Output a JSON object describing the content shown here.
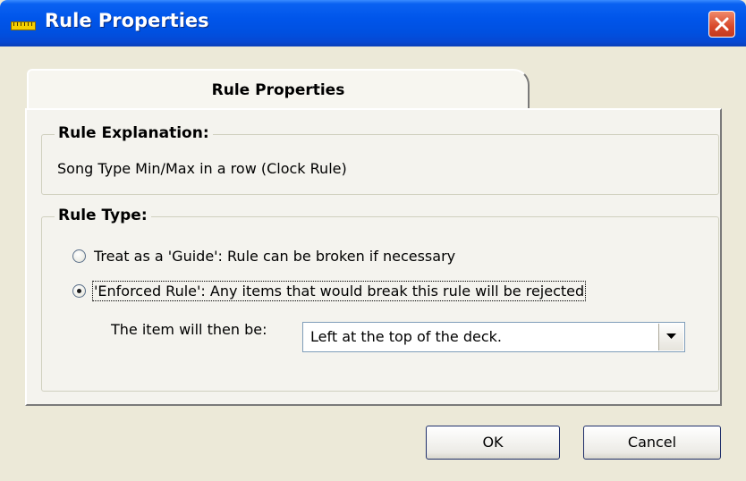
{
  "window": {
    "title": "Rule Properties",
    "title_icon": "ruler-icon",
    "close_icon": "close-icon"
  },
  "tab": {
    "label": "Rule Properties"
  },
  "explanation_group": {
    "legend": "Rule Explanation:",
    "text": "Song Type Min/Max in a row (Clock Rule)"
  },
  "rule_type_group": {
    "legend": "Rule Type:",
    "options": [
      {
        "label": "Treat as a 'Guide': Rule can be broken if necessary",
        "checked": false
      },
      {
        "label": "'Enforced Rule': Any items that would break this rule will be rejected",
        "checked": true
      }
    ],
    "select_label": "The item will then be:",
    "select_value": "Left at the top of the deck."
  },
  "buttons": {
    "ok": "OK",
    "cancel": "Cancel"
  },
  "colors": {
    "title_bar": "#0055ea",
    "close_button": "#d8482a",
    "dialog_bg": "#ece9d8"
  }
}
